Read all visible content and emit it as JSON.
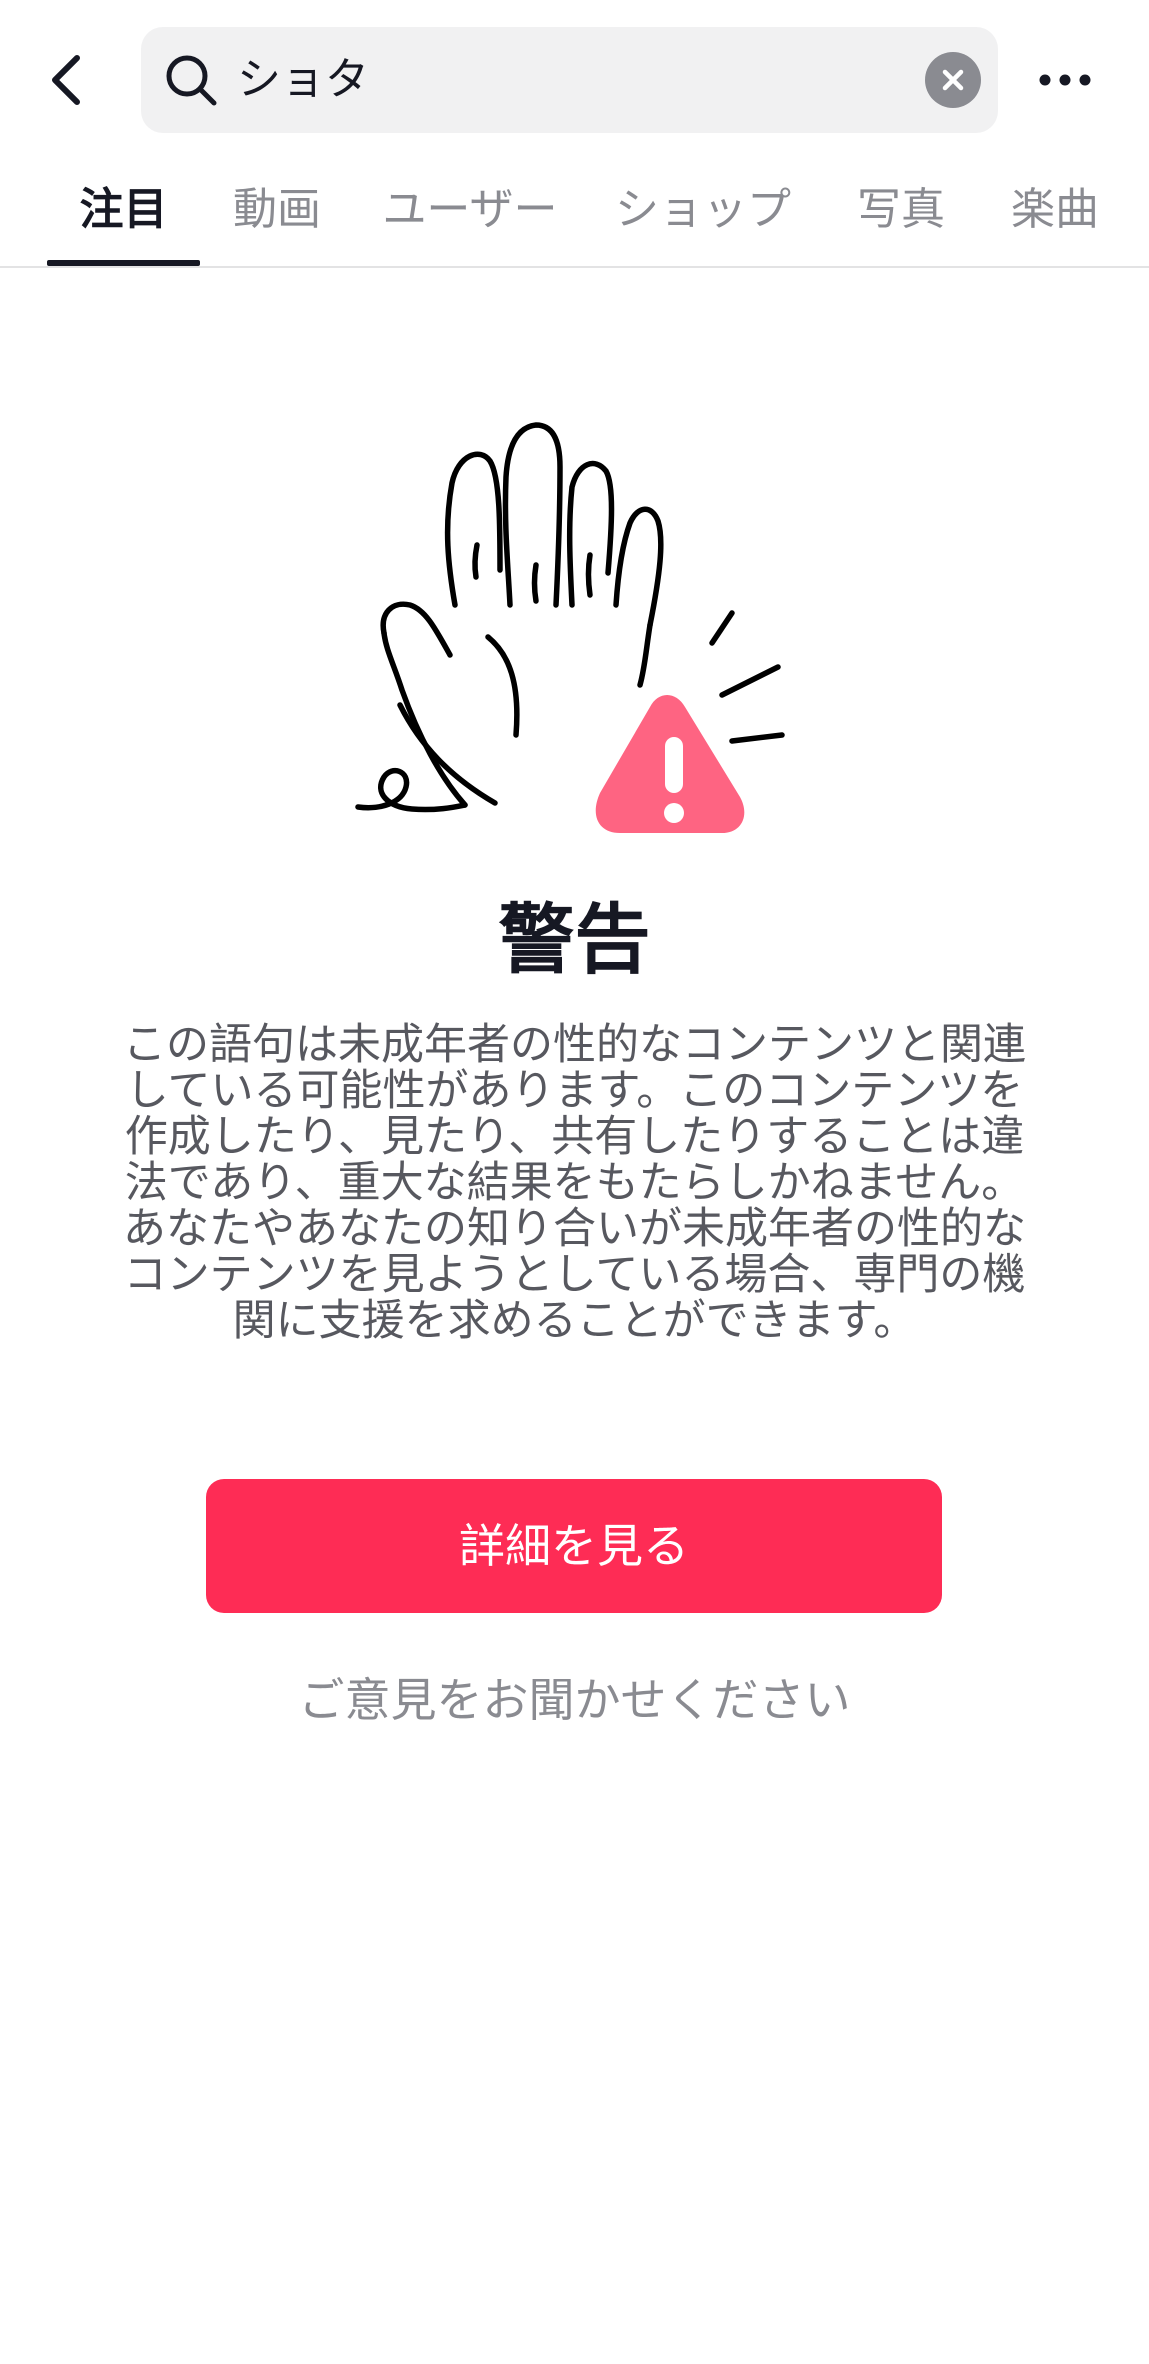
{
  "header": {
    "search_value": "ショタ",
    "icons": {
      "back": "chevron-left-icon",
      "search": "search-icon",
      "clear": "clear-icon",
      "more": "more-horizontal-icon"
    }
  },
  "tabs": [
    {
      "label": "注目",
      "active": true
    },
    {
      "label": "動画",
      "active": false
    },
    {
      "label": "ユーザー",
      "active": false
    },
    {
      "label": "ショップ",
      "active": false
    },
    {
      "label": "写真",
      "active": false
    },
    {
      "label": "楽曲",
      "active": false
    }
  ],
  "warning": {
    "illustration": "raised-hand-warning-icon",
    "title": "警告",
    "body": "この語句は未成年者の性的なコンテンツと関連している可能性があります。このコンテンツを作成したり、見たり、共有したりすることは違法であり、重大な結果をもたらしかねません。あなたやあなたの知り合いが未成年者の性的なコンテンツを見ようとしている場合、専門の機関に支援を求めることができます。",
    "primary_button": "詳細を見る",
    "feedback_link": "ご意見をお聞かせください"
  },
  "colors": {
    "accent": "#fe2c55",
    "warning_triangle": "#fe6482",
    "text_primary": "#161823",
    "text_secondary": "#8a8b91"
  }
}
